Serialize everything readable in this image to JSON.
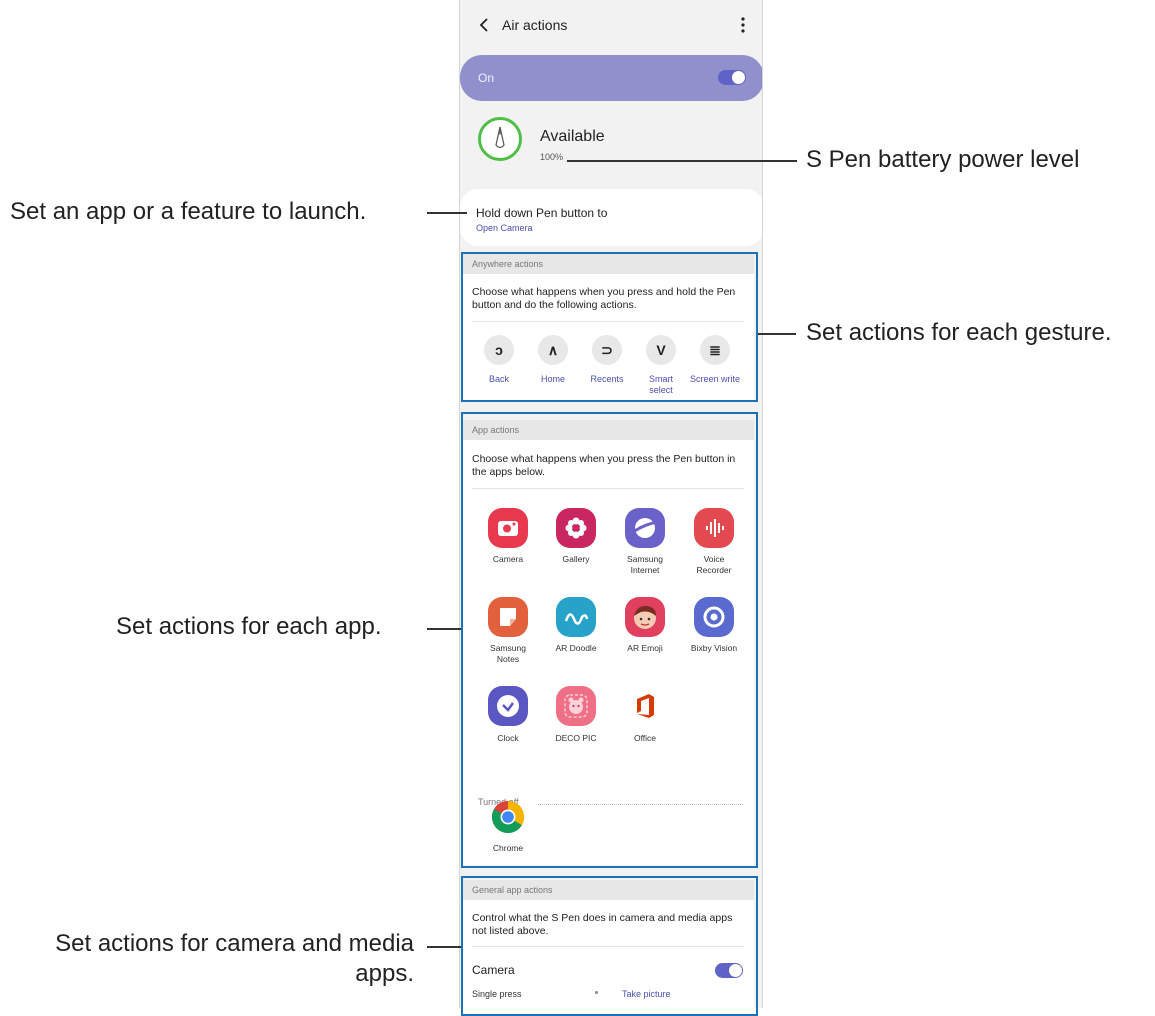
{
  "screen": {
    "title": "Air actions",
    "master_switch": {
      "label": "On",
      "state": true
    },
    "status": {
      "title": "Available",
      "battery": "100%"
    },
    "hold_button": {
      "label": "Hold down Pen button to",
      "value": "Open Camera"
    },
    "anywhere": {
      "header": "Anywhere actions",
      "description": "Choose what happens when you press and hold the Pen button and do the following actions.",
      "gestures": [
        {
          "icon": "back-gesture-icon",
          "label": "Back"
        },
        {
          "icon": "home-gesture-icon",
          "label": "Home"
        },
        {
          "icon": "recents-gesture-icon",
          "label": "Recents"
        },
        {
          "icon": "smart-select-gesture-icon",
          "label": "Smart select"
        },
        {
          "icon": "screen-write-gesture-icon",
          "label": "Screen write"
        }
      ]
    },
    "app_actions": {
      "header": "App actions",
      "description": "Choose what happens when you press the Pen button in the apps below.",
      "apps": [
        {
          "label": "Camera",
          "icon": "camera-app-icon",
          "color": "#e8394f"
        },
        {
          "label": "Gallery",
          "icon": "gallery-app-icon",
          "color": "#c8275f"
        },
        {
          "label": "Samsung Internet",
          "icon": "samsung-internet-app-icon",
          "color": "#6a61c9"
        },
        {
          "label": "Voice Recorder",
          "icon": "voice-recorder-app-icon",
          "color": "#e34a4f"
        },
        {
          "label": "Samsung Notes",
          "icon": "samsung-notes-app-icon",
          "color": "#e2603b"
        },
        {
          "label": "AR Doodle",
          "icon": "ar-doodle-app-icon",
          "color": "#27a2c9"
        },
        {
          "label": "AR Emoji",
          "icon": "ar-emoji-app-icon",
          "color": "#e0405e"
        },
        {
          "label": "Bixby Vision",
          "icon": "bixby-vision-app-icon",
          "color": "#5a6bcf"
        },
        {
          "label": "Clock",
          "icon": "clock-app-icon",
          "color": "#5a56c2"
        },
        {
          "label": "DECO PIC",
          "icon": "deco-pic-app-icon",
          "color": "#ef6f86"
        },
        {
          "label": "Office",
          "icon": "office-app-icon",
          "color": "#d83b01"
        }
      ],
      "turned_off_label": "Turned off",
      "turned_off_apps": [
        {
          "label": "Chrome",
          "icon": "chrome-app-icon"
        }
      ]
    },
    "general": {
      "header": "General app actions",
      "description": "Control what the S Pen does in camera and media apps not listed above.",
      "camera": {
        "label": "Camera",
        "state": true
      },
      "single_press": {
        "label": "Single press",
        "value": "Take picture"
      }
    }
  },
  "annotations": {
    "launch": "Set an app or a feature to launch.",
    "battery": "S Pen battery power level",
    "gesture": "Set actions for each gesture.",
    "app": "Set actions for each app.",
    "media_line1": "Set actions for camera and media",
    "media_line2": "apps."
  },
  "colors": {
    "accent": "#4b4fb0",
    "toggle_on": "#5f63c8",
    "master_bar": "#8f90cc",
    "battery_ring": "#4fbf47",
    "highlight_box": "#1a73b8"
  }
}
